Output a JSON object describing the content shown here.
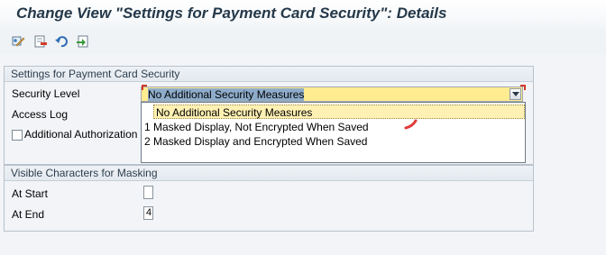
{
  "title": "Change View \"Settings for Payment Card Security\": Details",
  "toolbar": {
    "buttons": [
      "display-change-icon",
      "delete-icon",
      "undo-icon",
      "select-icon"
    ]
  },
  "settings_group": {
    "header": "Settings for Payment Card Security",
    "security_level_label": "Security Level",
    "security_level_value": "No Additional Security Measures",
    "access_log_label": "Access Log",
    "additional_auth_label": "Additional Authorization",
    "dropdown_options": [
      "No Additional Security Measures",
      "1 Masked Display, Not Encrypted When Saved",
      "2 Masked Display and Encrypted When Saved"
    ]
  },
  "masking_group": {
    "header": "Visible Characters for Masking",
    "at_start_label": "At Start",
    "at_start_value": "",
    "at_end_label": "At End",
    "at_end_value": "4"
  },
  "colors": {
    "title": "#243849",
    "field_yellow": "#ffec91",
    "required_marker": "#d03a2a"
  }
}
